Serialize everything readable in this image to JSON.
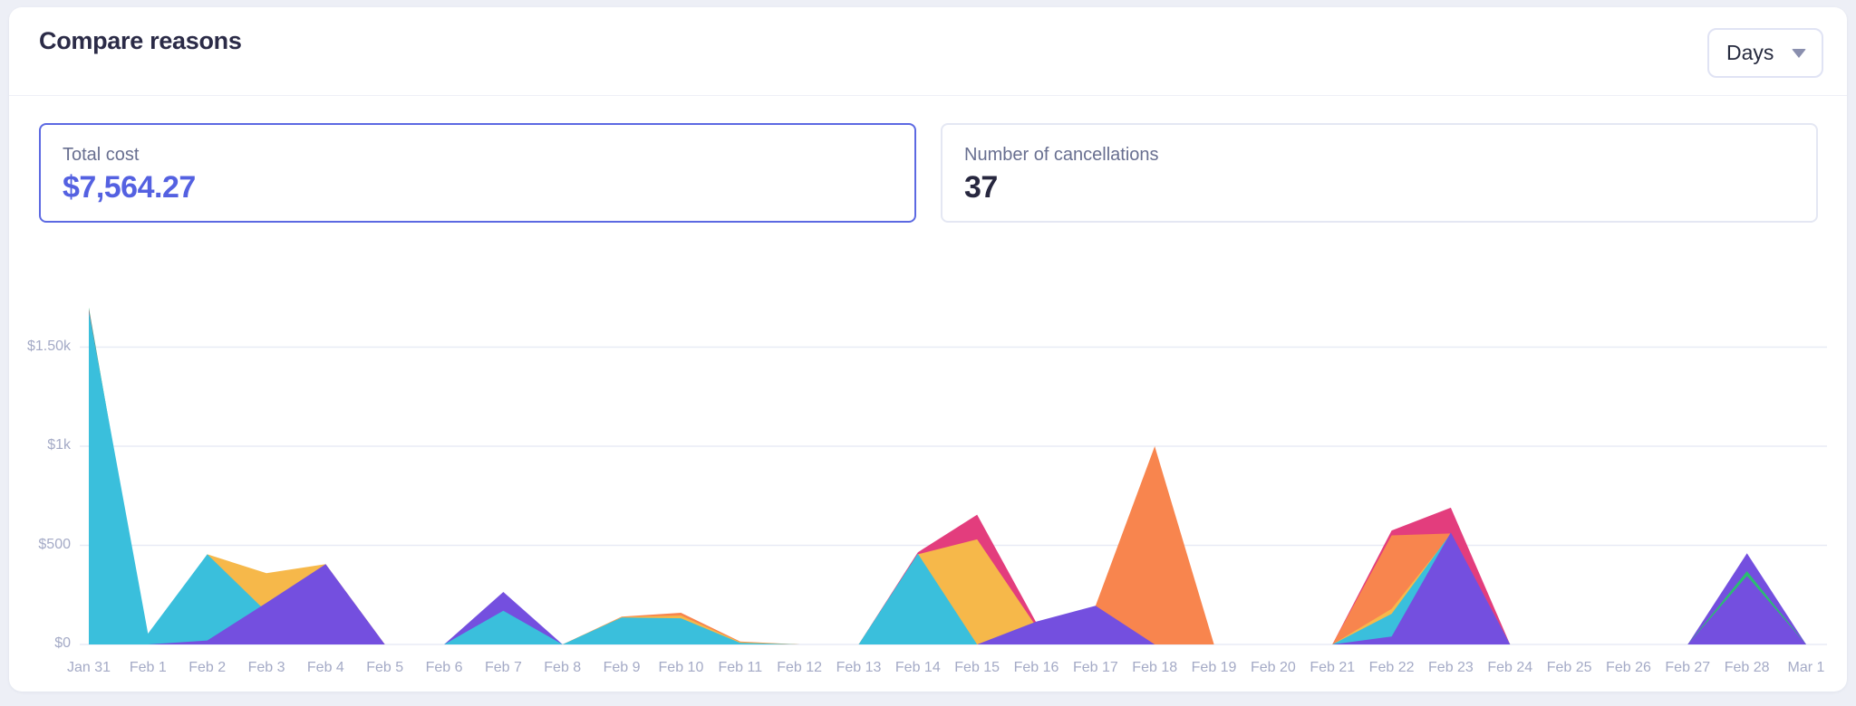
{
  "header": {
    "title": "Compare reasons",
    "period_selector": {
      "value": "Days"
    }
  },
  "stats": [
    {
      "label": "Total cost",
      "value": "$7,564.27",
      "highlighted": true,
      "value_color": "#5461e1",
      "border_color": "#5c69e2"
    },
    {
      "label": "Number of cancellations",
      "value": "37",
      "highlighted": false,
      "value_color": "#27273f",
      "border_color": "#e4e7f3"
    }
  ],
  "chart_data": {
    "type": "area",
    "mode": "overlapping-filled-areas-painted-in-series-order",
    "title": "",
    "xlabel": "",
    "ylabel": "",
    "legend_position": "none",
    "grid": "horizontal",
    "ylim": [
      0,
      1750
    ],
    "categories": [
      "Jan 31",
      "Feb 1",
      "Feb 2",
      "Feb 3",
      "Feb 4",
      "Feb 5",
      "Feb 6",
      "Feb 7",
      "Feb 8",
      "Feb 9",
      "Feb 10",
      "Feb 11",
      "Feb 12",
      "Feb 13",
      "Feb 14",
      "Feb 15",
      "Feb 16",
      "Feb 17",
      "Feb 18",
      "Feb 19",
      "Feb 20",
      "Feb 21",
      "Feb 22",
      "Feb 23",
      "Feb 24",
      "Feb 25",
      "Feb 26",
      "Feb 27",
      "Feb 28",
      "Mar 1"
    ],
    "y_axis": {
      "ticks": [
        {
          "label": "$0",
          "value": 0
        },
        {
          "label": "$500",
          "value": 500
        },
        {
          "label": "$1k",
          "value": 1000
        },
        {
          "label": "$1.50k",
          "value": 1500
        }
      ]
    },
    "series": [
      {
        "name": "purple-a",
        "color": "#744fdf",
        "values": [
          0,
          0,
          0,
          0,
          0,
          0,
          0,
          265,
          0,
          0,
          0,
          0,
          0,
          0,
          0,
          0,
          0,
          0,
          0,
          0,
          0,
          0,
          0,
          0,
          0,
          0,
          0,
          0,
          460,
          0
        ]
      },
      {
        "name": "green",
        "color": "#2abe70",
        "values": [
          1700,
          0,
          0,
          0,
          0,
          0,
          0,
          0,
          0,
          0,
          0,
          0,
          0,
          0,
          0,
          0,
          0,
          0,
          0,
          0,
          0,
          0,
          0,
          0,
          0,
          0,
          0,
          0,
          370,
          0
        ]
      },
      {
        "name": "pink",
        "color": "#e33d7d",
        "values": [
          1690,
          0,
          0,
          0,
          0,
          0,
          0,
          0,
          0,
          0,
          0,
          0,
          0,
          0,
          465,
          655,
          110,
          0,
          0,
          0,
          0,
          0,
          575,
          690,
          0,
          0,
          0,
          0,
          0,
          0
        ]
      },
      {
        "name": "orange",
        "color": "#f8854e",
        "values": [
          0,
          0,
          0,
          0,
          0,
          0,
          0,
          0,
          0,
          140,
          160,
          15,
          0,
          0,
          0,
          0,
          0,
          195,
          1000,
          0,
          0,
          0,
          550,
          560,
          0,
          0,
          0,
          0,
          0,
          0
        ]
      },
      {
        "name": "yellow",
        "color": "#f6b84a",
        "values": [
          0,
          0,
          455,
          360,
          405,
          0,
          0,
          0,
          0,
          138,
          146,
          12,
          0,
          0,
          455,
          530,
          90,
          0,
          0,
          0,
          0,
          0,
          180,
          555,
          0,
          0,
          0,
          0,
          0,
          0
        ]
      },
      {
        "name": "cyan",
        "color": "#3abfdc",
        "values": [
          1680,
          55,
          455,
          165,
          0,
          0,
          0,
          170,
          0,
          136,
          132,
          8,
          0,
          0,
          458,
          0,
          0,
          0,
          0,
          0,
          0,
          0,
          155,
          560,
          0,
          0,
          0,
          0,
          0,
          0
        ]
      },
      {
        "name": "purple-b",
        "color": "#744fdf",
        "values": [
          0,
          0,
          20,
          210,
          405,
          0,
          0,
          0,
          0,
          0,
          0,
          0,
          0,
          0,
          0,
          0,
          115,
          195,
          0,
          0,
          0,
          0,
          40,
          565,
          0,
          0,
          0,
          0,
          345,
          0
        ]
      }
    ]
  }
}
